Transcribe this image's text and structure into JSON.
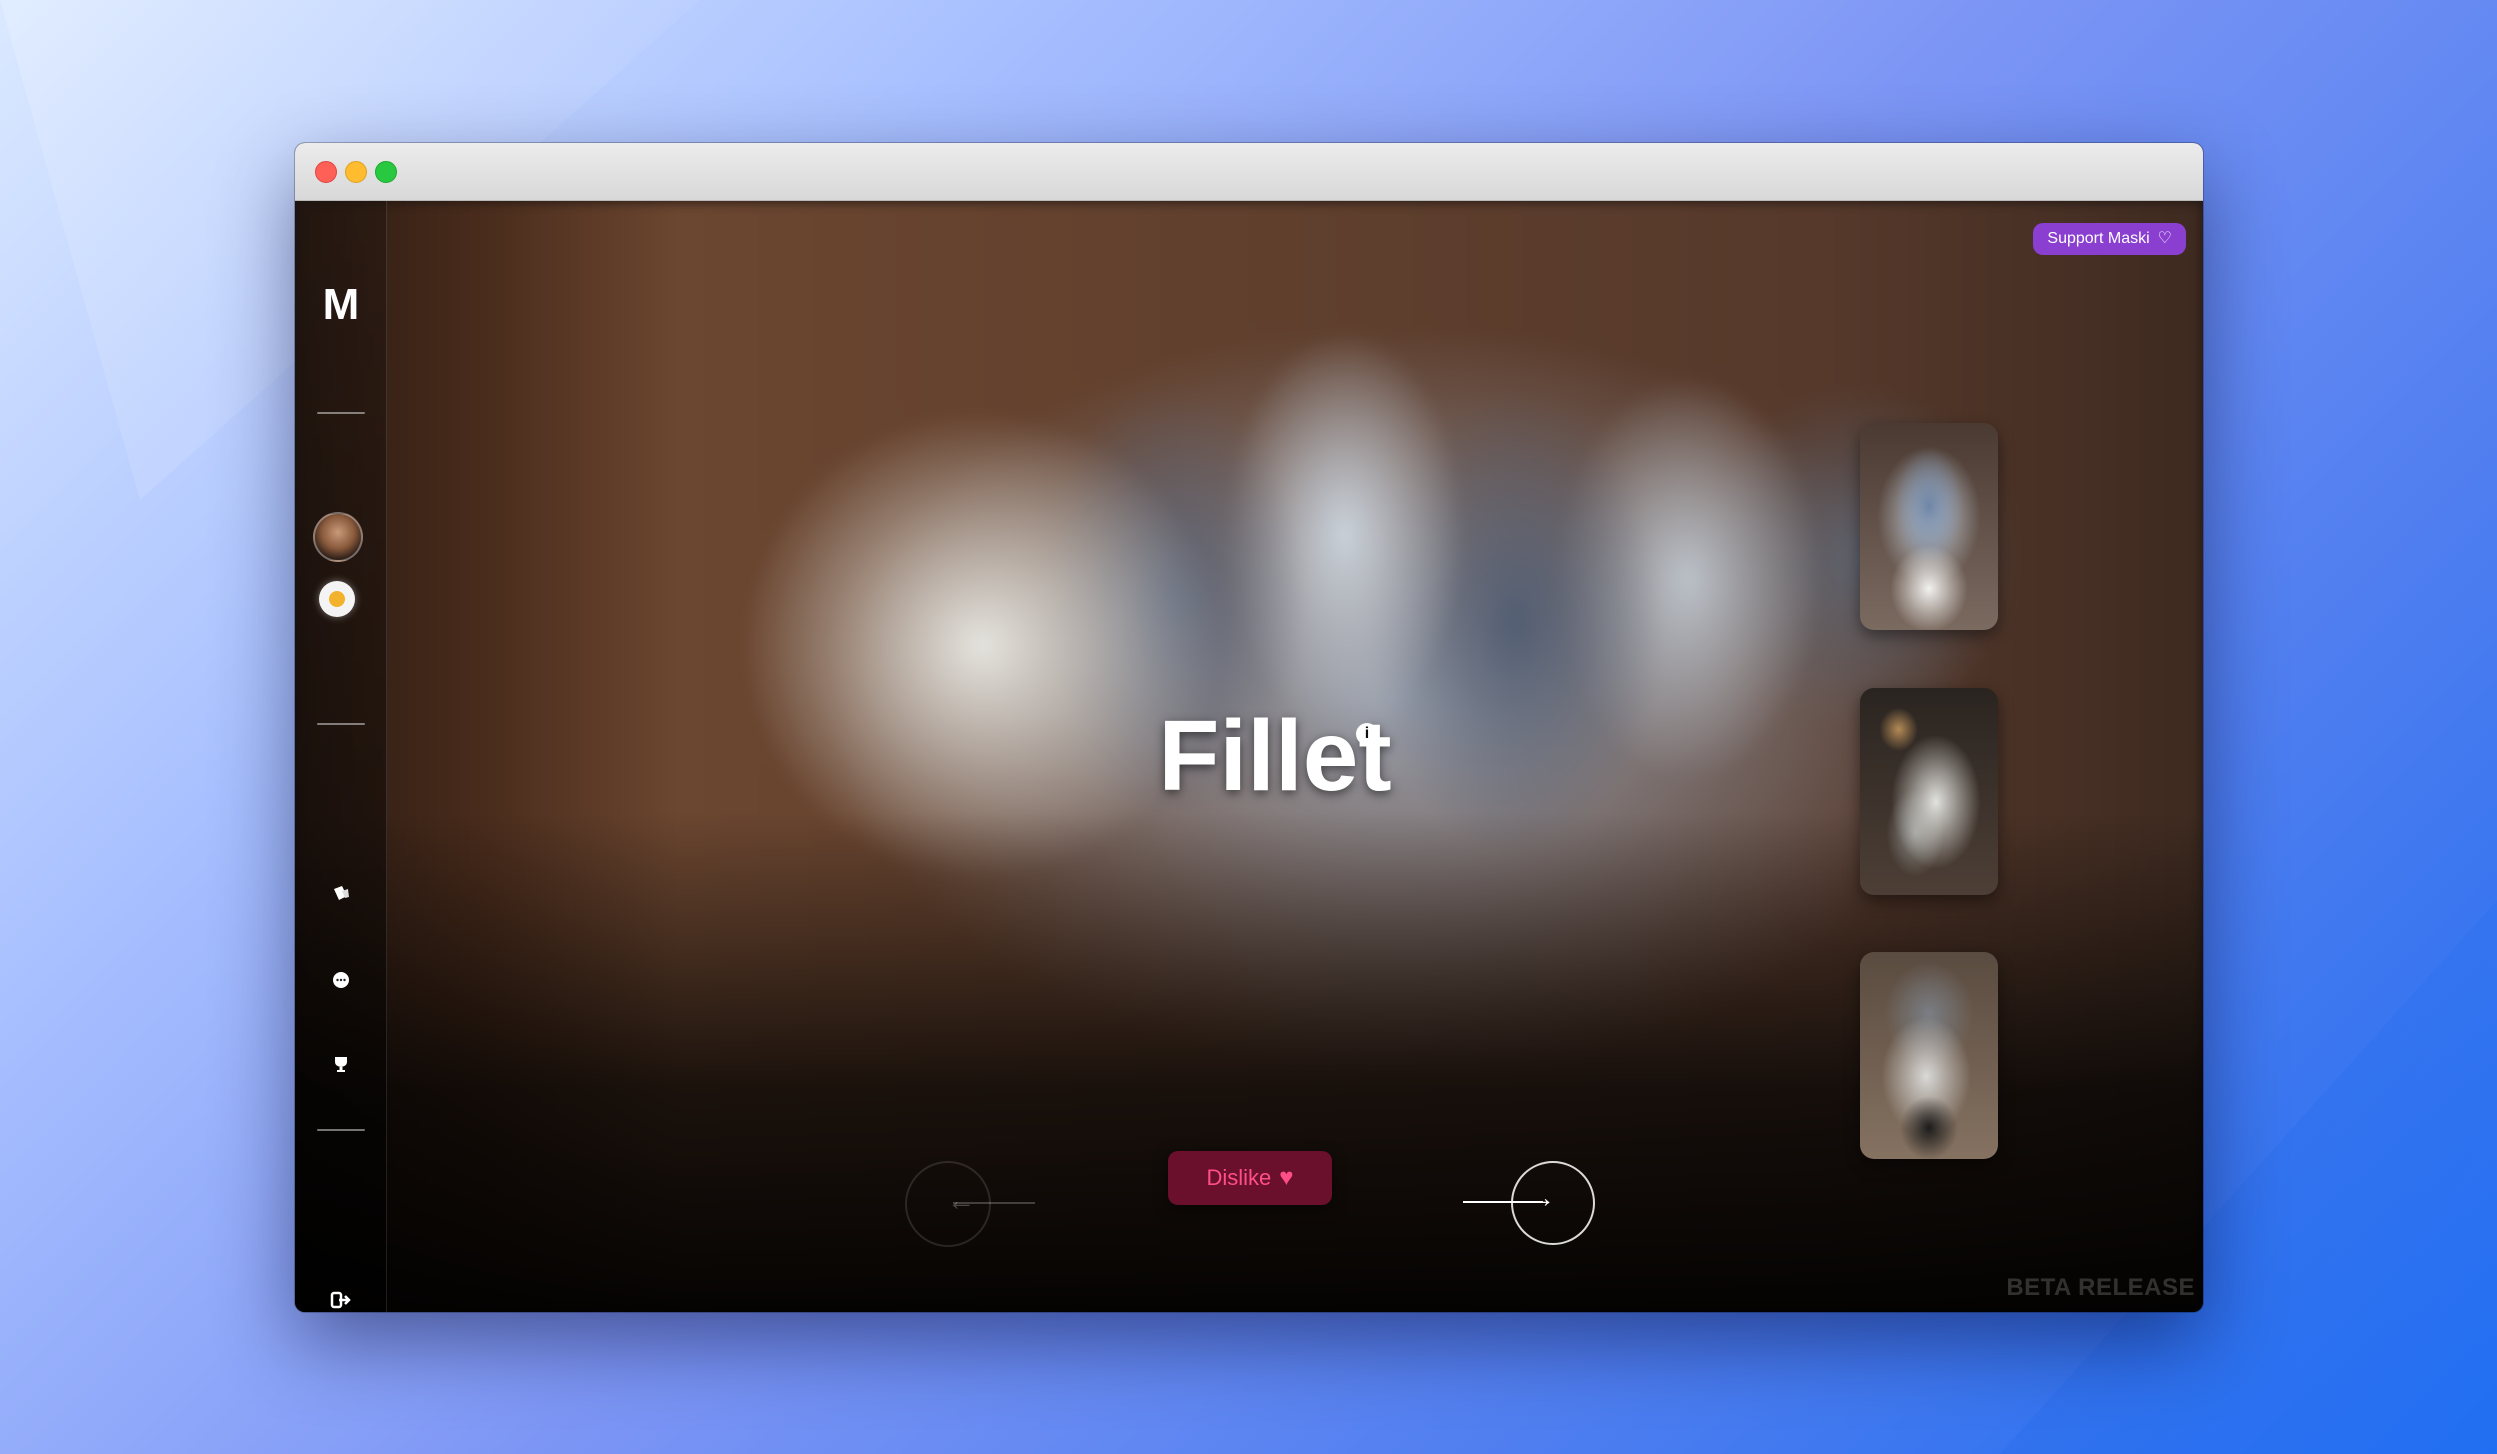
{
  "window": {
    "traffic_lights": [
      "close",
      "minimize",
      "zoom"
    ]
  },
  "app": {
    "logo_text": "M",
    "support_button": {
      "label": "Support Maski",
      "icon": "heart-outline-icon"
    },
    "sidebar": {
      "icons": [
        "avatar",
        "sun-icon",
        "cards-icon",
        "chat-icon",
        "trophy-icon",
        "logout-icon"
      ]
    },
    "dog": {
      "name": "Fillet",
      "info_icon": "i"
    },
    "actions": {
      "dislike_label": "Dislike",
      "dislike_icon": "heart-icon"
    },
    "footer": {
      "badge": "BETA RELEASE"
    }
  },
  "colors": {
    "support_bg": "#8a3fd1",
    "dislike_bg": "#6a0f2c",
    "dislike_text": "#ff4f86"
  }
}
